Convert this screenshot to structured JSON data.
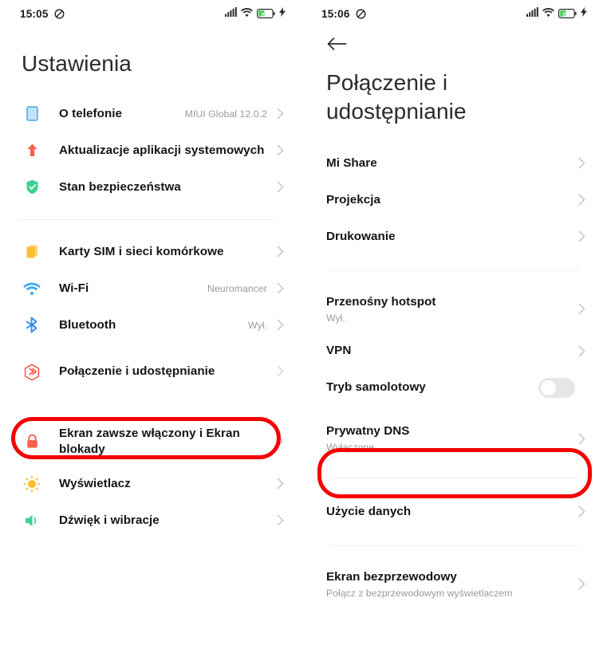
{
  "left": {
    "status": {
      "time": "15:05",
      "dnd_icon": "do-not-disturb-icon",
      "signal_icon": "cellular-signal-icon",
      "wifi_icon": "wifi-icon",
      "battery_level": "22",
      "charging_icon": "charging-bolt-icon"
    },
    "title": "Ustawienia",
    "groups": [
      {
        "items": [
          {
            "icon": "phone-info-icon",
            "label": "O telefonie",
            "value": "MIUI Global 12.0.2"
          },
          {
            "icon": "system-update-arrow-icon",
            "label": "Aktualizacje aplikacji systemowych",
            "value": ""
          },
          {
            "icon": "security-shield-icon",
            "label": "Stan bezpieczeństwa",
            "value": ""
          }
        ]
      },
      {
        "items": [
          {
            "icon": "sim-cards-icon",
            "label": "Karty SIM i sieci komórkowe",
            "value": ""
          },
          {
            "icon": "wifi-icon",
            "label": "Wi-Fi",
            "value": "Neuromancer"
          },
          {
            "icon": "bluetooth-icon",
            "label": "Bluetooth",
            "value": "Wył."
          },
          {
            "icon": "connection-sharing-icon",
            "label": "Połączenie i udostępnianie",
            "value": "",
            "highlighted": true
          }
        ]
      },
      {
        "items": [
          {
            "icon": "lock-icon",
            "label": "Ekran zawsze włączony i Ekran blokady",
            "value": ""
          },
          {
            "icon": "brightness-sun-icon",
            "label": "Wyświetlacz",
            "value": ""
          },
          {
            "icon": "sound-speaker-icon",
            "label": "Dźwięk i wibracje",
            "value": ""
          }
        ]
      }
    ]
  },
  "right": {
    "status": {
      "time": "15:06",
      "dnd_icon": "do-not-disturb-icon",
      "signal_icon": "cellular-signal-icon",
      "wifi_icon": "wifi-icon",
      "battery_level": "22",
      "charging_icon": "charging-bolt-icon"
    },
    "back_icon": "back-arrow-icon",
    "title": "Połączenie i udostępnianie",
    "groups": [
      {
        "items": [
          {
            "label": "Mi Share",
            "sub": ""
          },
          {
            "label": "Projekcja",
            "sub": ""
          },
          {
            "label": "Drukowanie",
            "sub": ""
          }
        ]
      },
      {
        "items": [
          {
            "label": "Przenośny hotspot",
            "sub": "Wył."
          },
          {
            "label": "VPN",
            "sub": ""
          },
          {
            "label": "Tryb samolotowy",
            "sub": "",
            "toggle": true,
            "toggle_on": false
          },
          {
            "label": "Prywatny DNS",
            "sub": "Wyłączone",
            "highlighted": true
          }
        ]
      },
      {
        "items": [
          {
            "label": "Użycie danych",
            "sub": ""
          }
        ]
      },
      {
        "items": [
          {
            "label": "Ekran bezprzewodowy",
            "sub": "Połącz z bezprzewodowym wyświetlaczem"
          }
        ]
      }
    ]
  },
  "colors": {
    "highlight_red": "#f40000",
    "icon_blue": "#8ecbf0",
    "icon_red": "#f8604f",
    "icon_green": "#3fcf8e",
    "icon_yellow": "#fbc02d",
    "icon_wifi": "#3ba7f0",
    "icon_bluetooth": "#2e8ef7",
    "icon_connection": "#f2553d",
    "icon_sound": "#3fcf8e"
  }
}
